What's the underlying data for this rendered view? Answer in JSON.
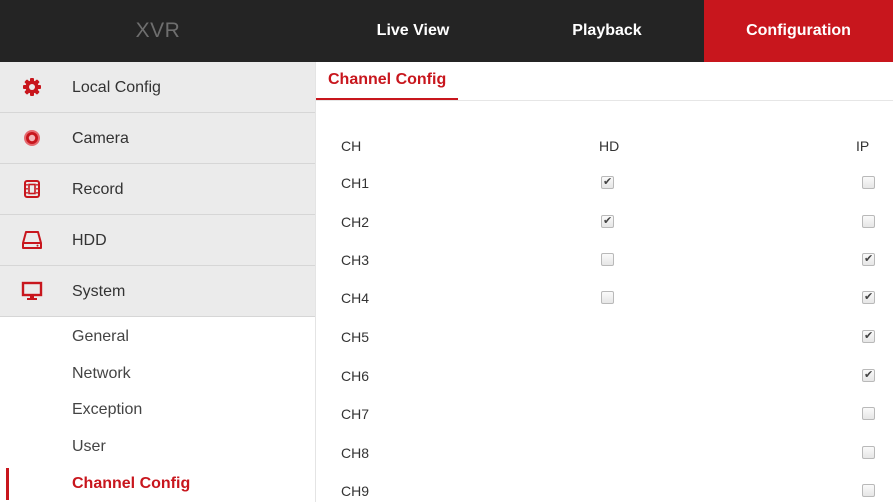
{
  "header": {
    "brand": "XVR",
    "nav": [
      "Live View",
      "Playback",
      "Configuration"
    ],
    "active_nav": "Configuration"
  },
  "sidebar": {
    "items": [
      {
        "label": "Local Config",
        "icon": "gear-icon"
      },
      {
        "label": "Camera",
        "icon": "camera-icon"
      },
      {
        "label": "Record",
        "icon": "record-icon"
      },
      {
        "label": "HDD",
        "icon": "hdd-icon"
      },
      {
        "label": "System",
        "icon": "monitor-icon"
      }
    ],
    "subitems": [
      "General",
      "Network",
      "Exception",
      "User",
      "Channel Config"
    ],
    "active_subitem": "Channel Config"
  },
  "content": {
    "tab": "Channel Config",
    "columns": [
      "CH",
      "HD",
      "IP"
    ],
    "rows": [
      {
        "ch": "CH1",
        "hd": true,
        "ip": false
      },
      {
        "ch": "CH2",
        "hd": true,
        "ip": false
      },
      {
        "ch": "CH3",
        "hd": false,
        "ip": true
      },
      {
        "ch": "CH4",
        "hd": false,
        "ip": true
      },
      {
        "ch": "CH5",
        "hd": null,
        "ip": true
      },
      {
        "ch": "CH6",
        "hd": null,
        "ip": true
      },
      {
        "ch": "CH7",
        "hd": null,
        "ip": false
      },
      {
        "ch": "CH8",
        "hd": null,
        "ip": false
      },
      {
        "ch": "CH9",
        "hd": null,
        "ip": false
      }
    ]
  },
  "colors": {
    "accent": "#c8161d",
    "topbar": "#242424",
    "sidebar_item_bg": "#ebebeb"
  }
}
